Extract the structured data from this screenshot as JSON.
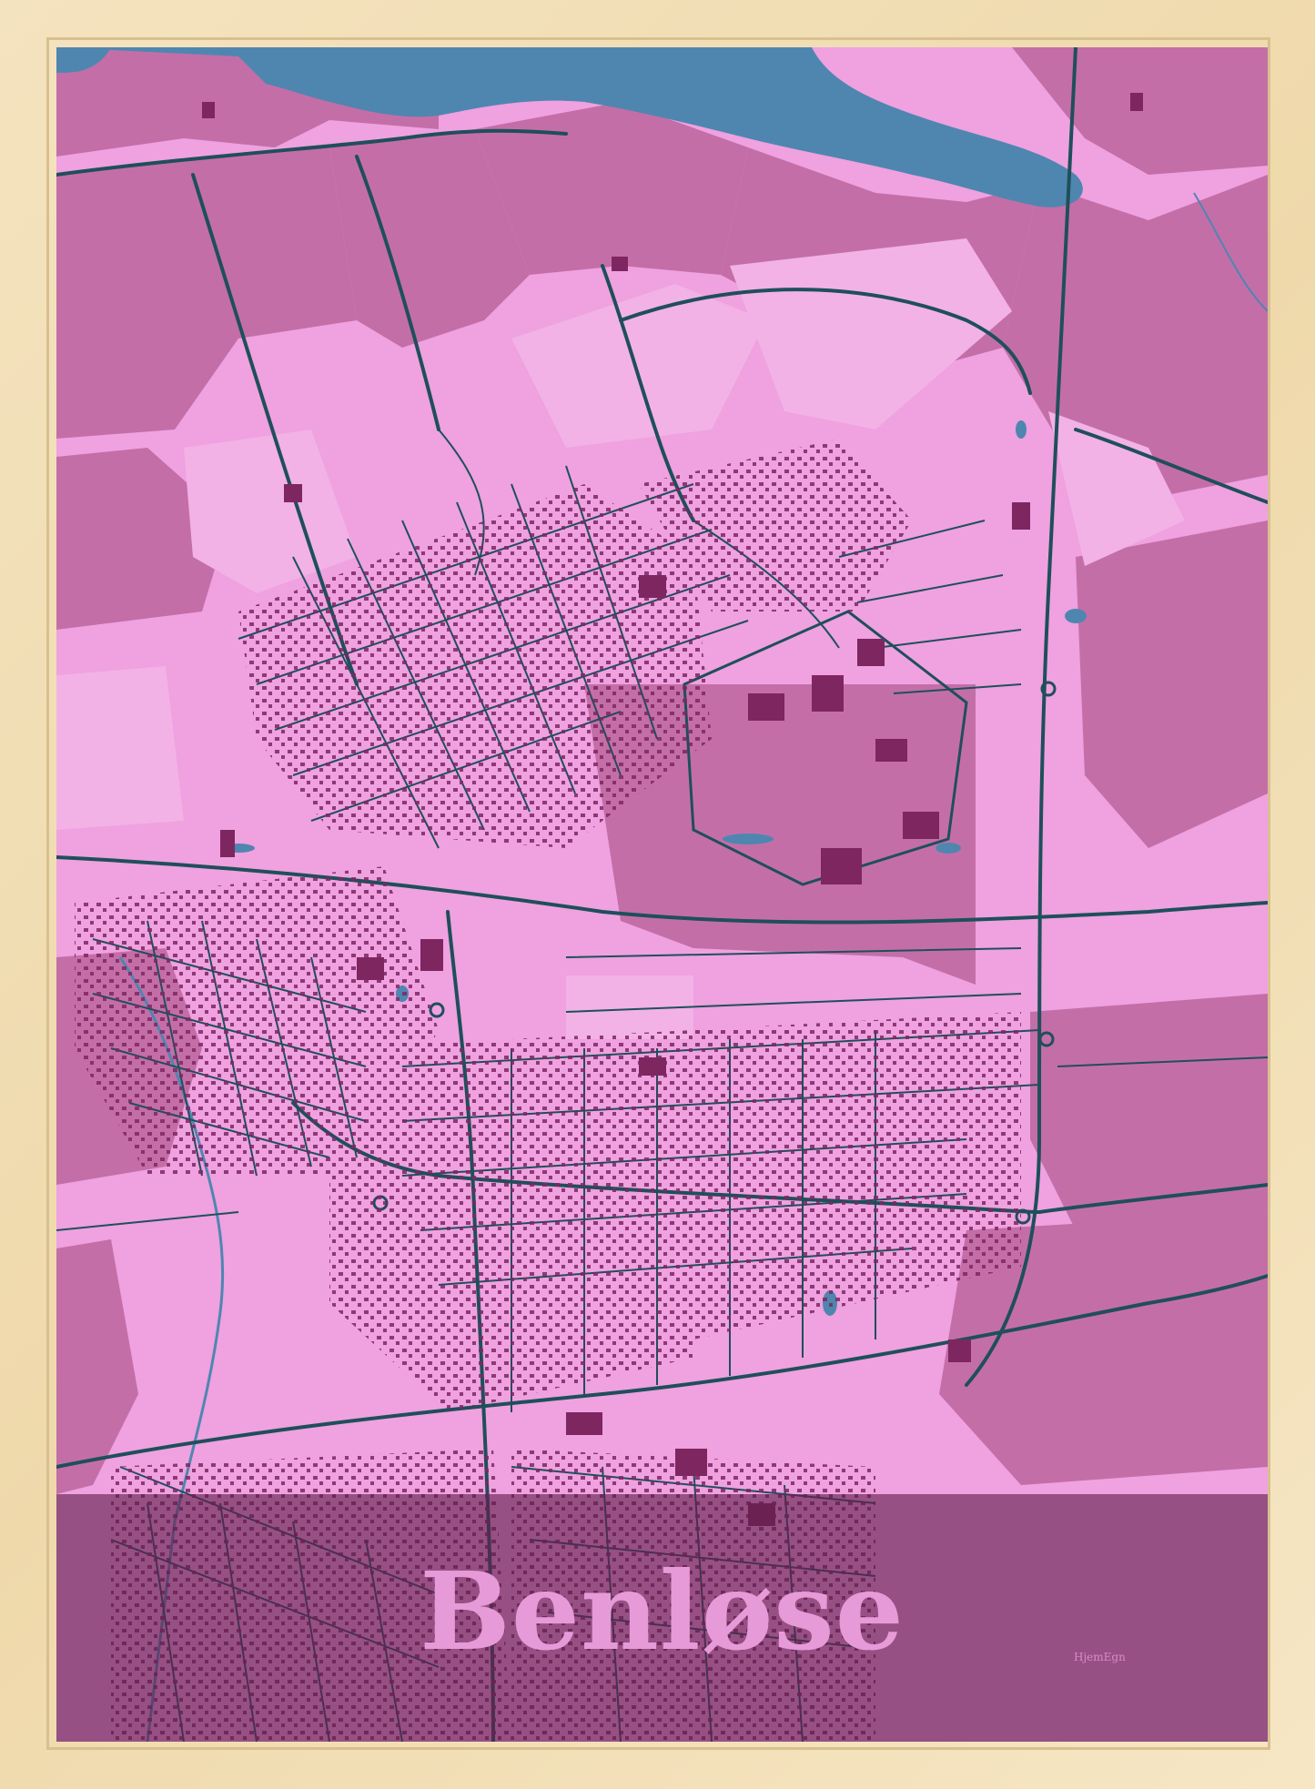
{
  "poster": {
    "title": "Benløse",
    "signature": "HjemEgn"
  },
  "colors": {
    "frame": "#efd9ab",
    "background": "#efa1e0",
    "fields": "#c46ea8",
    "buildings": "#7e2660",
    "roads": "#1f4f5a",
    "water": "#4f86b0",
    "banner": "#5f1e4b",
    "title_text": "#e79ad8"
  }
}
